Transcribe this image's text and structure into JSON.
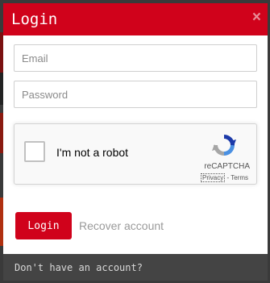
{
  "modal": {
    "title": "Login",
    "close_symbol": "×"
  },
  "form": {
    "email": {
      "placeholder": "Email",
      "value": ""
    },
    "password": {
      "placeholder": "Password",
      "value": ""
    }
  },
  "recaptcha": {
    "label": "I'm not a robot",
    "brand": "reCAPTCHA",
    "privacy_link": "Privacy",
    "separator": "-",
    "terms_link": "Terms",
    "checked": false,
    "logo_icon": "recaptcha-logo"
  },
  "actions": {
    "login_label": "Login",
    "recover_label": "Recover account"
  },
  "footer": {
    "text": "Don't have an account?"
  },
  "colors": {
    "accent": "#d0021b",
    "footer_bg": "#444444",
    "overlay": "#3a3a3a"
  }
}
